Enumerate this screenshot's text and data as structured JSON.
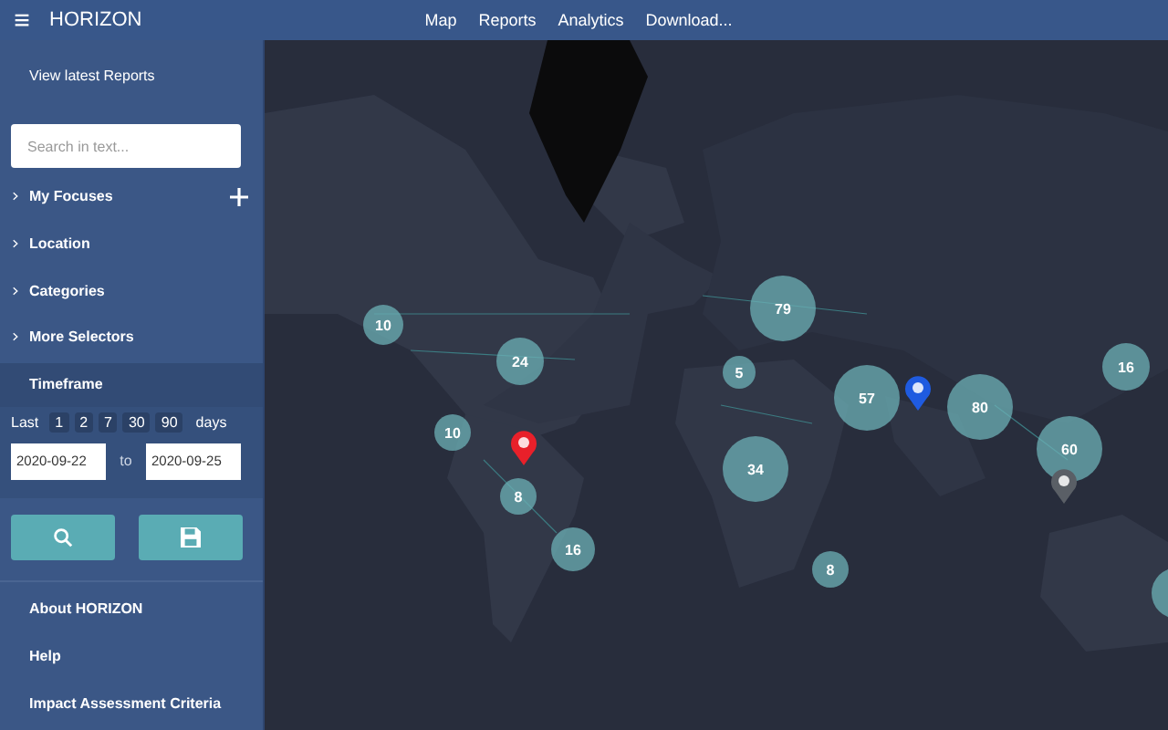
{
  "header": {
    "menu_icon": "≡",
    "title": "HORIZON",
    "nav": [
      "Map",
      "Reports",
      "Analytics",
      "Download..."
    ]
  },
  "sidebar": {
    "latest_link": "View latest Reports",
    "search": {
      "placeholder": "Search in text..."
    },
    "filters": [
      {
        "label": "My Focuses",
        "expanded": false,
        "addable": true
      },
      {
        "label": "Location",
        "expanded": false,
        "addable": false
      },
      {
        "label": "Categories",
        "expanded": false,
        "addable": false
      },
      {
        "label": "More Selectors",
        "expanded": false,
        "addable": false
      }
    ],
    "timeframe": {
      "title": "Timeframe",
      "prefix": "Last",
      "presets": [
        "1",
        "2",
        "7",
        "30",
        "90"
      ],
      "suffix": "days",
      "from": "2020-09-22",
      "separator": "to",
      "until": "2020-09-25"
    },
    "footer_links": [
      "About HORIZON",
      "Help",
      "Impact Assessment Criteria"
    ]
  },
  "map": {
    "kind": "picture",
    "markers": [
      {
        "kind": "cluster",
        "count": "10"
      },
      {
        "kind": "cluster",
        "count": "24"
      },
      {
        "kind": "cluster",
        "count": "79"
      },
      {
        "kind": "cluster",
        "count": "5"
      },
      {
        "kind": "cluster",
        "count": "57"
      },
      {
        "kind": "cluster",
        "count": "80"
      },
      {
        "kind": "cluster",
        "count": "16"
      },
      {
        "kind": "cluster",
        "count": "34"
      },
      {
        "kind": "cluster",
        "count": "60"
      },
      {
        "kind": "cluster",
        "count": "10"
      },
      {
        "kind": "cluster",
        "count": "8"
      },
      {
        "kind": "cluster",
        "count": "16"
      },
      {
        "kind": "cluster",
        "count": "8"
      },
      {
        "kind": "cluster"
      },
      {
        "kind": "pin",
        "color": "#e8202a"
      },
      {
        "kind": "pin",
        "color": "#1f5be0"
      },
      {
        "kind": "pin",
        "color": "#5a5f66"
      }
    ]
  }
}
